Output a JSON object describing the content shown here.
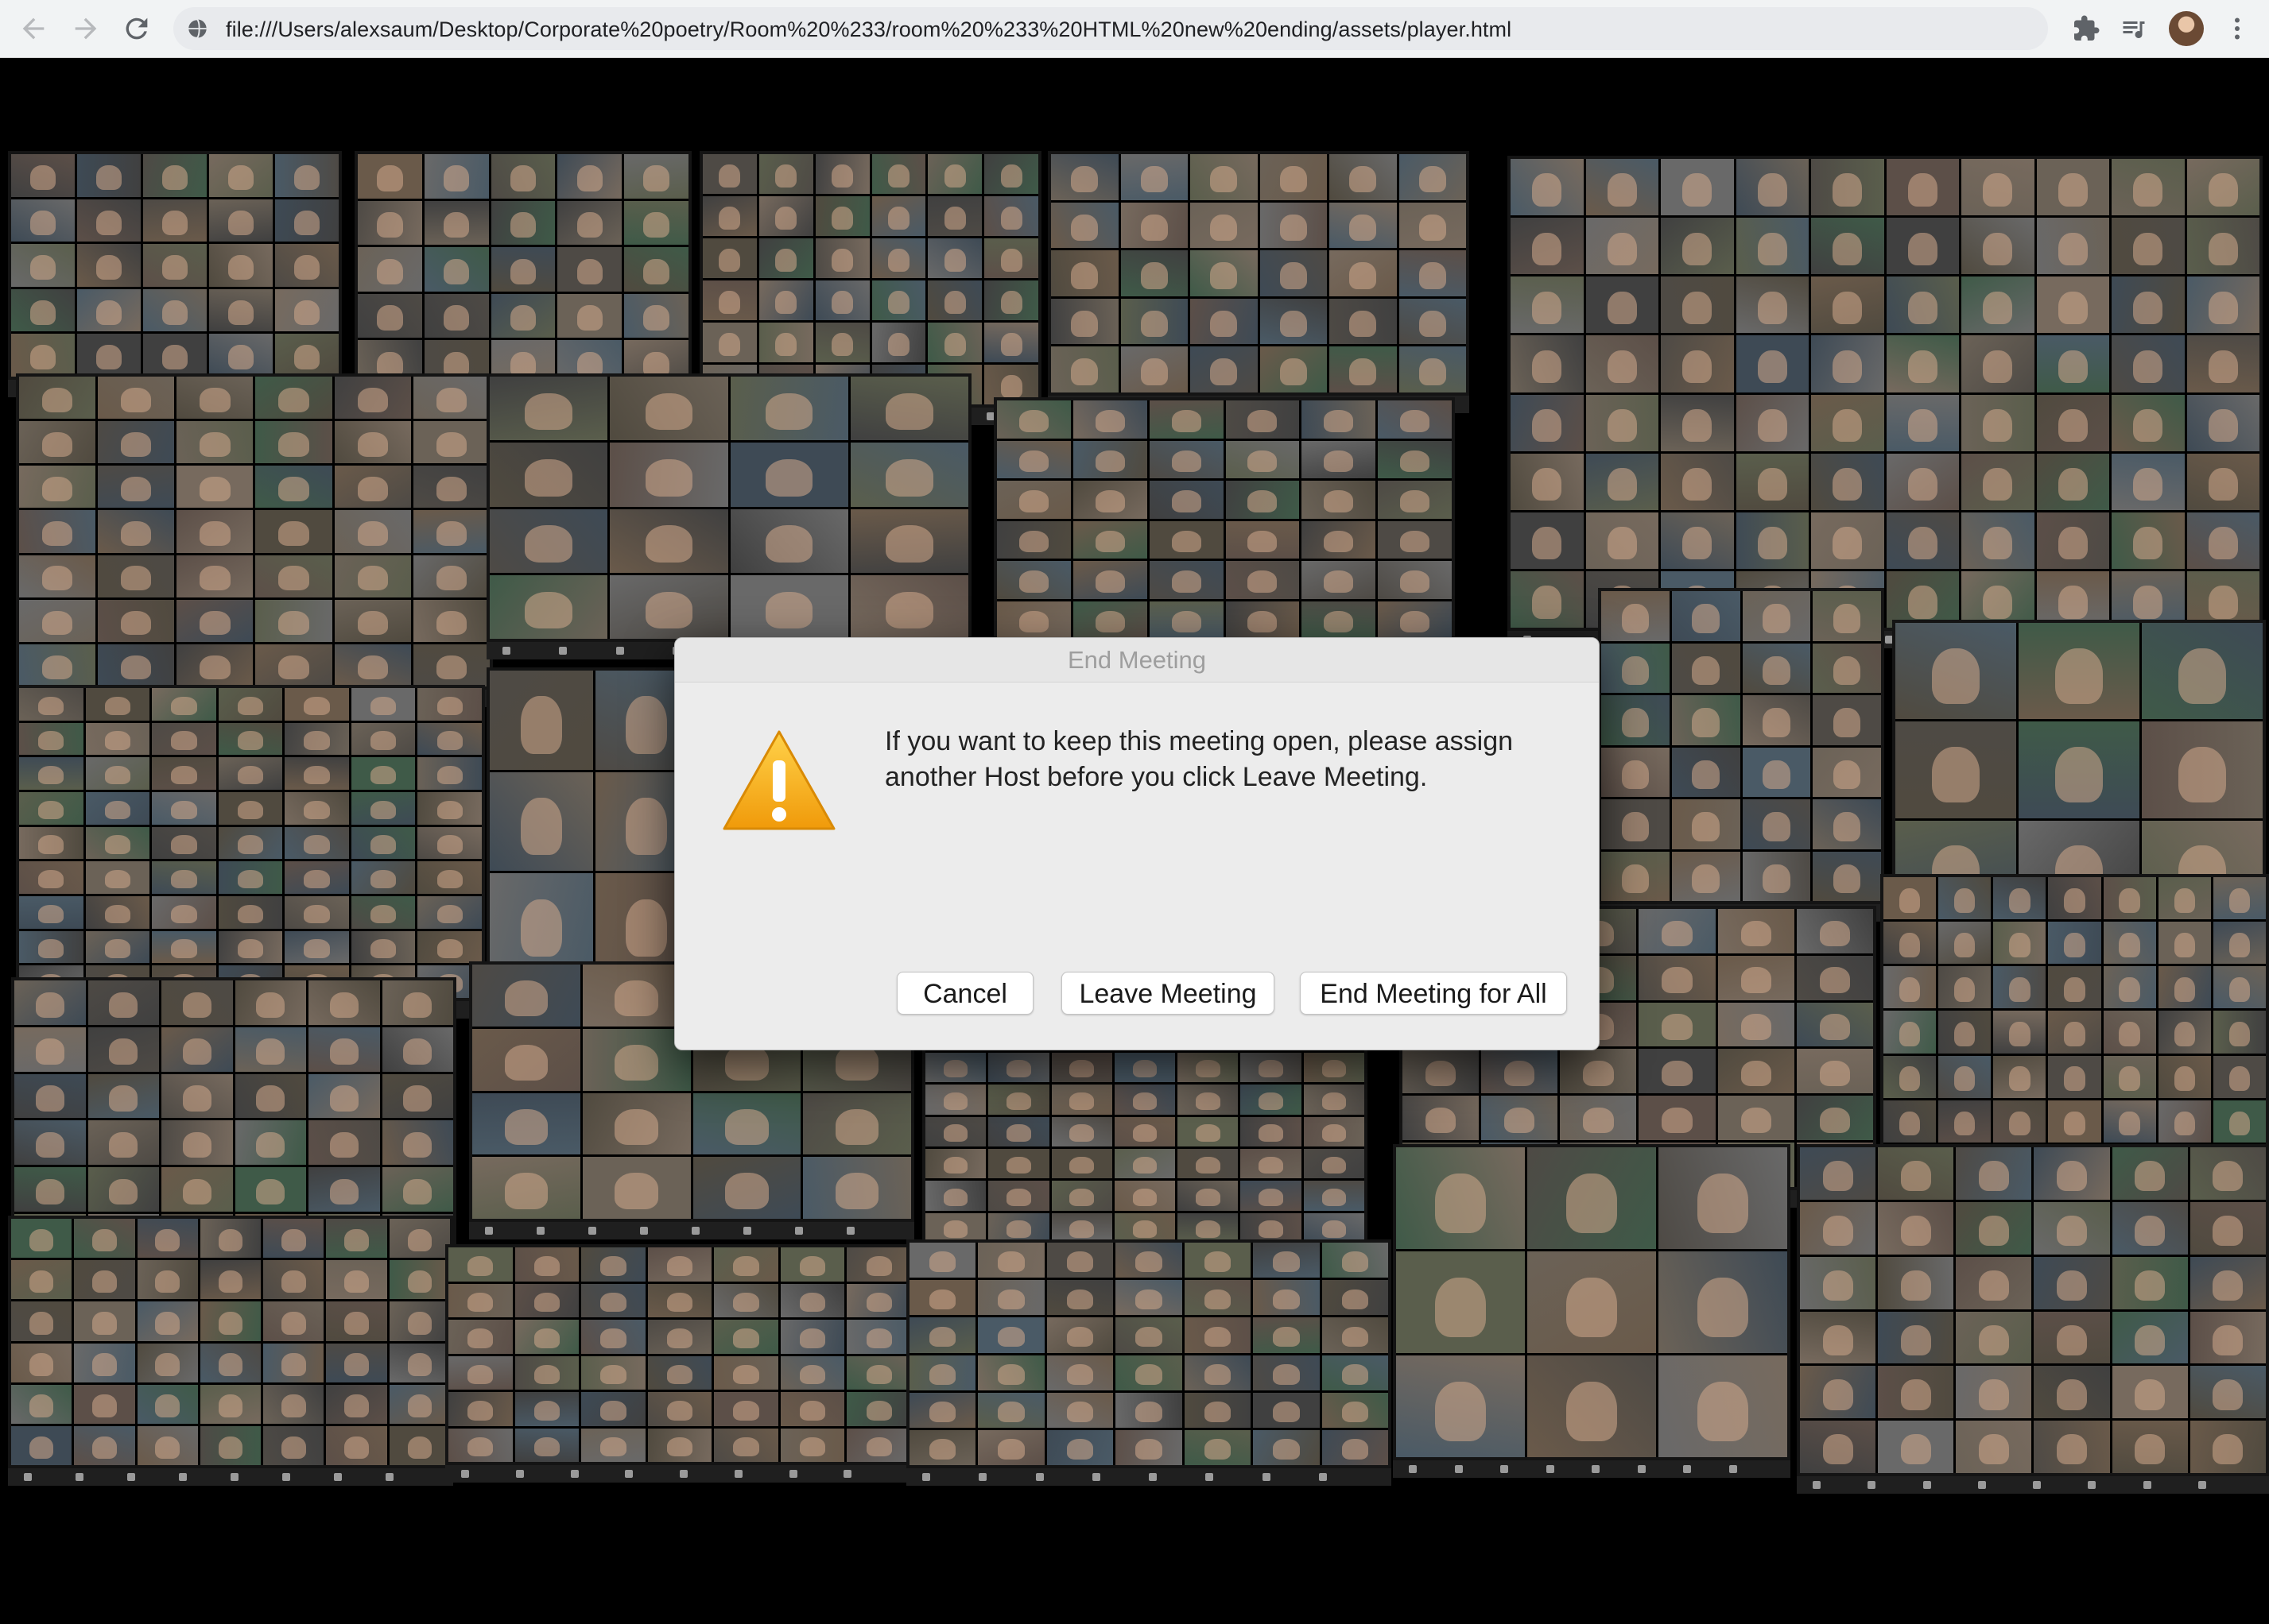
{
  "browser": {
    "url": "file:///Users/alexsaum/Desktop/Corporate%20poetry/Room%20%233/room%20%233%20HTML%20new%20ending/assets/player.html",
    "icons": [
      "back-arrow-icon",
      "forward-arrow-icon",
      "reload-icon",
      "globe-icon",
      "puzzle-piece-icon",
      "media-control-icon",
      "profile-avatar",
      "kebab-menu-icon"
    ]
  },
  "collage": {
    "description_icon": "zoom-meeting-gallery-screenshots"
  },
  "dialog": {
    "title": "End Meeting",
    "message": "If you want to keep this meeting open, please assign another Host before you click Leave Meeting.",
    "buttons": {
      "cancel": "Cancel",
      "leave": "Leave Meeting",
      "end_all": "End Meeting for All"
    },
    "icon": "warning-triangle-icon"
  },
  "colors": {
    "warning": "#f3a511",
    "chrome_bg": "#f1f3f4",
    "dialog_bg": "#ececec",
    "page_bg": "#000000"
  }
}
